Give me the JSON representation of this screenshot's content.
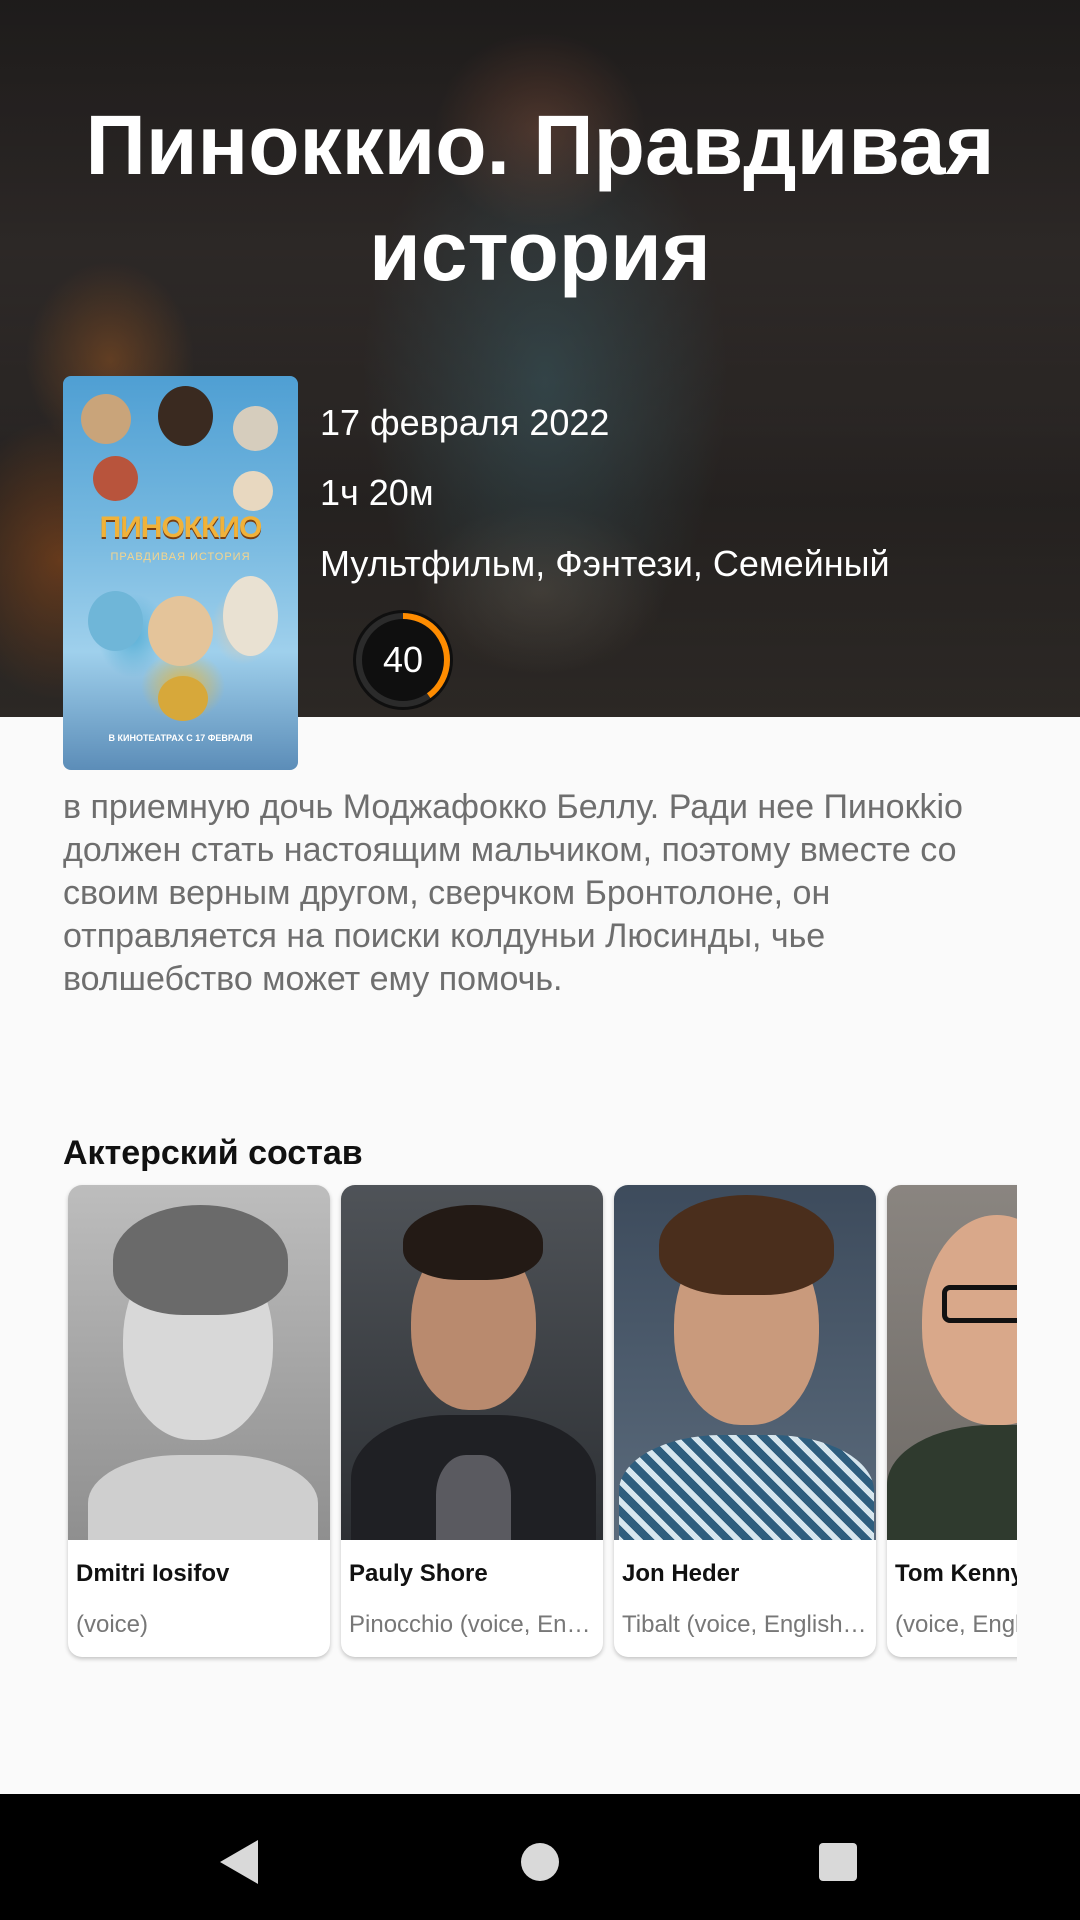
{
  "movie": {
    "title": "Пиноккио. Правдивая история",
    "release_date": "17 февраля 2022",
    "runtime": "1ч 20м",
    "genres": "Мультфильм, Фэнтези, Семейный",
    "score": "40",
    "score_fraction": 0.4,
    "score_color": "#ff8c00",
    "poster": {
      "title": "ПИНОККИО",
      "subtitle": "ПРАВДИВАЯ ИСТОРИЯ",
      "date_line": "В КИНОТЕАТРАХ С 17 ФЕВРАЛЯ"
    }
  },
  "overview": "в приемную дочь Моджафокко Беллу. Ради нее Пинокkio должен стать настоящим мальчиком, поэтому вместе со своим верным другом, сверчком Бронтолоне, он отправляется на поиски колдуньи Люсинды, чье волшебство может ему помочь.",
  "cast_section": {
    "heading": "Актерский состав",
    "members": [
      {
        "name": "Dmitri Iosifov",
        "role": "(voice)"
      },
      {
        "name": "Pauly Shore",
        "role": "Pinocchio (voice, English)"
      },
      {
        "name": "Jon Heder",
        "role": "Tibalt (voice, English version)"
      },
      {
        "name": "Tom Kenny",
        "role": "(voice, English version)"
      }
    ]
  },
  "navigation": {
    "back_icon": "back-triangle-icon",
    "home_icon": "home-circle-icon",
    "recents_icon": "recents-square-icon"
  }
}
